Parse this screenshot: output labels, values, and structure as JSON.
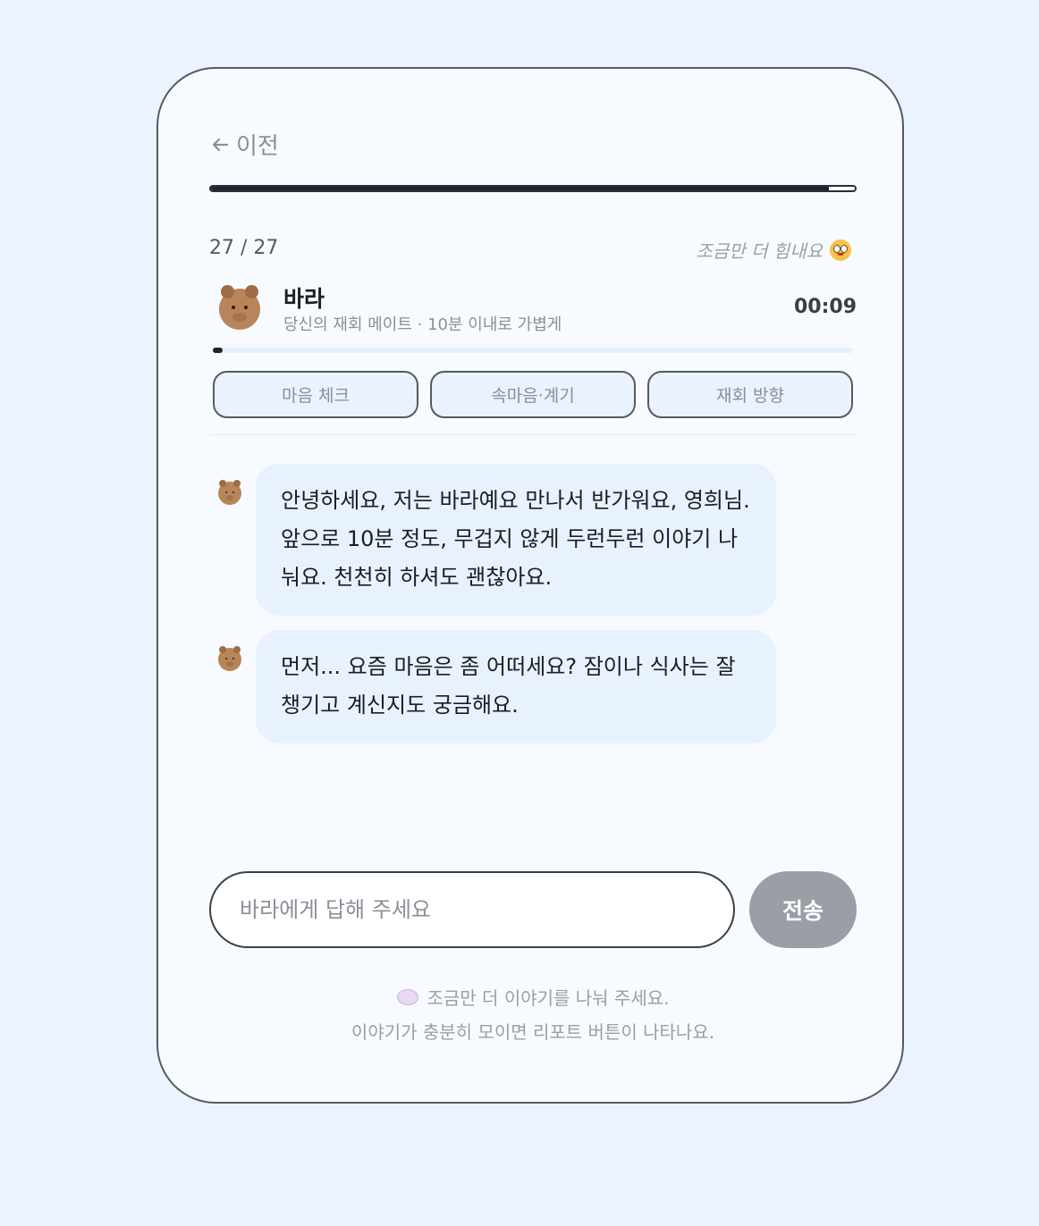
{
  "header": {
    "back_label": "이전",
    "progress_fraction": 0.96
  },
  "step": {
    "counter": "27 / 27",
    "cheer_text": "조금만 더 힘내요"
  },
  "mate": {
    "name": "바라",
    "subtitle": "당신의 재회 메이트 · 10분 이내로 가볍게",
    "timer": "00:09",
    "timer_fraction": 0.015
  },
  "tabs": [
    {
      "label": "마음 체크"
    },
    {
      "label": "속마음·계기"
    },
    {
      "label": "재회 방향"
    }
  ],
  "messages": [
    {
      "text": "안녕하세요, 저는 바라예요 만나서 반가워요, 영희님. 앞으로 10분 정도, 무겁지 않게 두런두런 이야기 나눠요. 천천히 하셔도 괜찮아요."
    },
    {
      "text": "먼저... 요즘 마음은 좀 어떠세요? 잠이나 식사는 잘 챙기고 계신지도 궁금해요."
    }
  ],
  "composer": {
    "placeholder": "바라에게 답해 주세요",
    "value": "",
    "send_label": "전송"
  },
  "hint": {
    "line1": "조금만 더 이야기를 나눠 주세요.",
    "line2": "이야기가 충분히 모이면 리포트 버튼이 나타나요."
  },
  "icons": {
    "back": "arrow-left-icon",
    "cheer": "smiling-face-icon",
    "avatar": "bear-face-icon",
    "hint": "speech-bubble-icon"
  },
  "colors": {
    "background": "#eaf3fe",
    "card": "#f7fbff",
    "bubble": "#e8f2fe",
    "send_disabled": "#9a9ea6",
    "progress": "#1f242c"
  }
}
